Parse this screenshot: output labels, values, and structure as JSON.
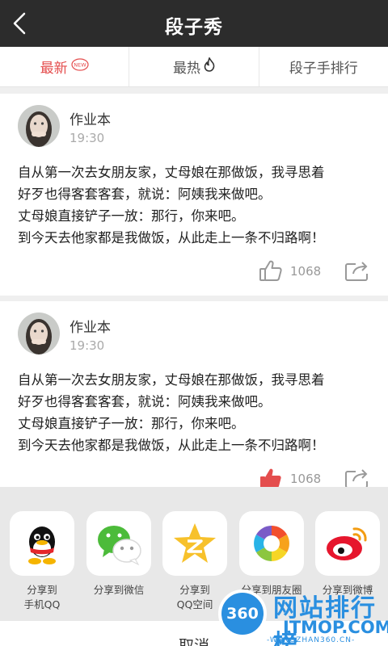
{
  "header": {
    "title": "段子秀",
    "back_icon": "chevron-left-icon"
  },
  "tabs": [
    {
      "label": "最新",
      "badge": "NEW",
      "active": true
    },
    {
      "label": "最热",
      "icon": "flame-icon"
    },
    {
      "label": "段子手排行"
    }
  ],
  "posts": [
    {
      "user": "作业本",
      "time": "19:30",
      "lines": [
        "自从第一次去女朋友家，丈母娘在那做饭，我寻思着",
        "好歹也得客套客套，就说：阿姨我来做吧。",
        "丈母娘直接铲子一放：那行，你来吧。",
        "到今天去他家都是我做饭，从此走上一条不归路啊！"
      ],
      "likes": "1068",
      "liked": false
    },
    {
      "user": "作业本",
      "time": "19:30",
      "lines": [
        "自从第一次去女朋友家，丈母娘在那做饭，我寻思着",
        "好歹也得客套客套，就说：阿姨我来做吧。",
        "丈母娘直接铲子一放：那行，你来吧。",
        "到今天去他家都是我做饭，从此走上一条不归路啊！"
      ],
      "likes": "1068",
      "liked": true
    }
  ],
  "share_sheet": {
    "items": [
      {
        "line1": "分享到",
        "line2": "手机QQ",
        "icon": "qq-icon"
      },
      {
        "line1": "分享到微信",
        "line2": "",
        "icon": "wechat-icon"
      },
      {
        "line1": "分享到",
        "line2": "QQ空间",
        "icon": "qzone-icon"
      },
      {
        "line1": "分享到朋友圈",
        "line2": "",
        "icon": "moments-icon"
      },
      {
        "line1": "分享到微博",
        "line2": "",
        "icon": "weibo-icon"
      }
    ],
    "cancel": "取消"
  },
  "watermark": {
    "badge": "360",
    "name": "网站排行榜",
    "sub": "ITMOP.COM",
    "url": "-WANGZHAN360.CN-"
  },
  "colors": {
    "accent": "#e44d4d",
    "header_bg": "#2c2c2c",
    "sheet_bg": "#e8e8e8",
    "watermark": "#2a8fe0"
  }
}
